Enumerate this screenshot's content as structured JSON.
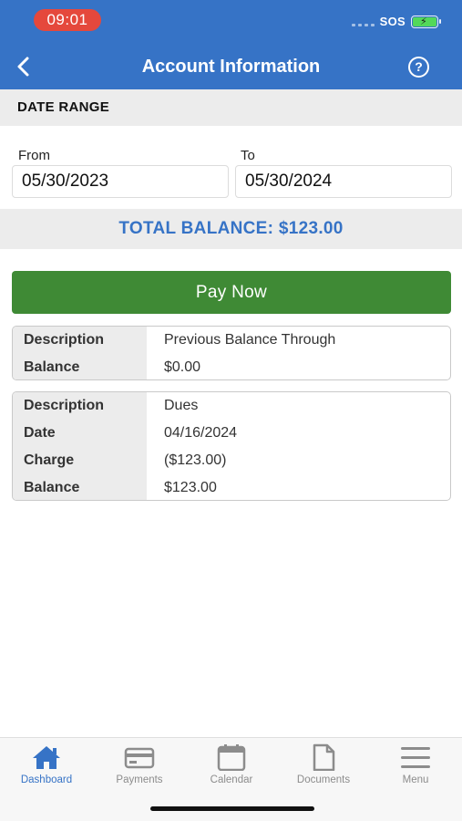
{
  "status": {
    "time": "09:01",
    "carrier": "SOS"
  },
  "header": {
    "title": "Account Information"
  },
  "date_range": {
    "section_title": "DATE RANGE",
    "from_label": "From",
    "from_value": "05/30/2023",
    "to_label": "To",
    "to_value": "05/30/2024"
  },
  "total": {
    "text": "TOTAL BALANCE: $123.00"
  },
  "pay": {
    "label": "Pay Now"
  },
  "transactions": [
    {
      "rows": [
        {
          "key": "Description",
          "value": "Previous Balance Through"
        },
        {
          "key": "Balance",
          "value": "$0.00"
        }
      ]
    },
    {
      "rows": [
        {
          "key": "Description",
          "value": "Dues"
        },
        {
          "key": "Date",
          "value": "04/16/2024"
        },
        {
          "key": "Charge",
          "value": "($123.00)"
        },
        {
          "key": "Balance",
          "value": "$123.00"
        }
      ]
    }
  ],
  "tabs": [
    {
      "label": "Dashboard",
      "icon": "home-icon"
    },
    {
      "label": "Payments",
      "icon": "credit-card-icon"
    },
    {
      "label": "Calendar",
      "icon": "calendar-icon"
    },
    {
      "label": "Documents",
      "icon": "document-icon"
    },
    {
      "label": "Menu",
      "icon": "menu-icon"
    }
  ],
  "colors": {
    "brand": "#3673c6",
    "pay": "#3f8a35",
    "inactive": "#8c8c8c"
  }
}
